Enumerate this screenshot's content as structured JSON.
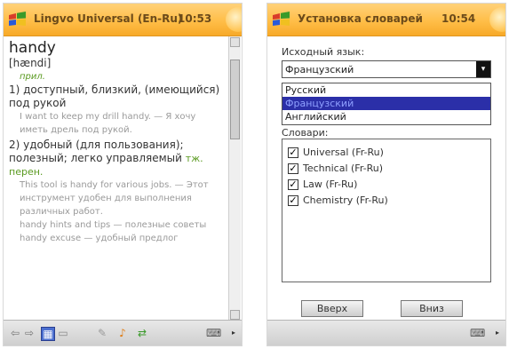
{
  "left_screen": {
    "title": "Lingvo Universal (En-Ru)",
    "time": "10:53",
    "entry": {
      "headword": "handy",
      "transcription": "[hændi]",
      "pos": "прил.",
      "senses": [
        {
          "text": "1) доступный, близкий, (имеющийся) под рукой",
          "pos_note": "",
          "examples": [
            "I want to keep my drill handy. — Я хочу иметь дрель под рукой."
          ]
        },
        {
          "text": "2) удобный (для пользования); полезный; легко управляемый",
          "pos_note": "тж. перен.",
          "examples": [
            "This tool is handy for various jobs. — Этот инструмент удобен для выполнения различных работ.",
            "handy hints and tips — полезные советы",
            "handy excuse — удобный предлог"
          ]
        }
      ]
    },
    "toolbar_icons": [
      "back-arrow-icon",
      "forward-arrow-icon",
      "card-view-icon",
      "history-icon",
      "tools-icon",
      "sound-icon",
      "translate-icon",
      "keyboard-icon"
    ]
  },
  "right_screen": {
    "title": "Установка словарей",
    "time": "10:54",
    "source_language_label": "Исходный язык:",
    "source_language_value": "Французский",
    "dropdown_options": [
      "Русский",
      "Французский",
      "Английский"
    ],
    "dictionaries_label": "Словари:",
    "dictionaries": [
      {
        "label": "Universal (Fr-Ru)",
        "checked": true
      },
      {
        "label": "Technical (Fr-Ru)",
        "checked": true
      },
      {
        "label": "Law (Fr-Ru)",
        "checked": true
      },
      {
        "label": "Chemistry (Fr-Ru)",
        "checked": true
      }
    ],
    "buttons": {
      "up": "Вверх",
      "down": "Вниз"
    },
    "colors": {
      "selection": "#2b2fa8"
    }
  },
  "colors": {
    "titlebar": "#ffbe48",
    "toolbar": "#d8d8d8",
    "pos": "#5a9a20",
    "example": "#9a9a9a"
  }
}
